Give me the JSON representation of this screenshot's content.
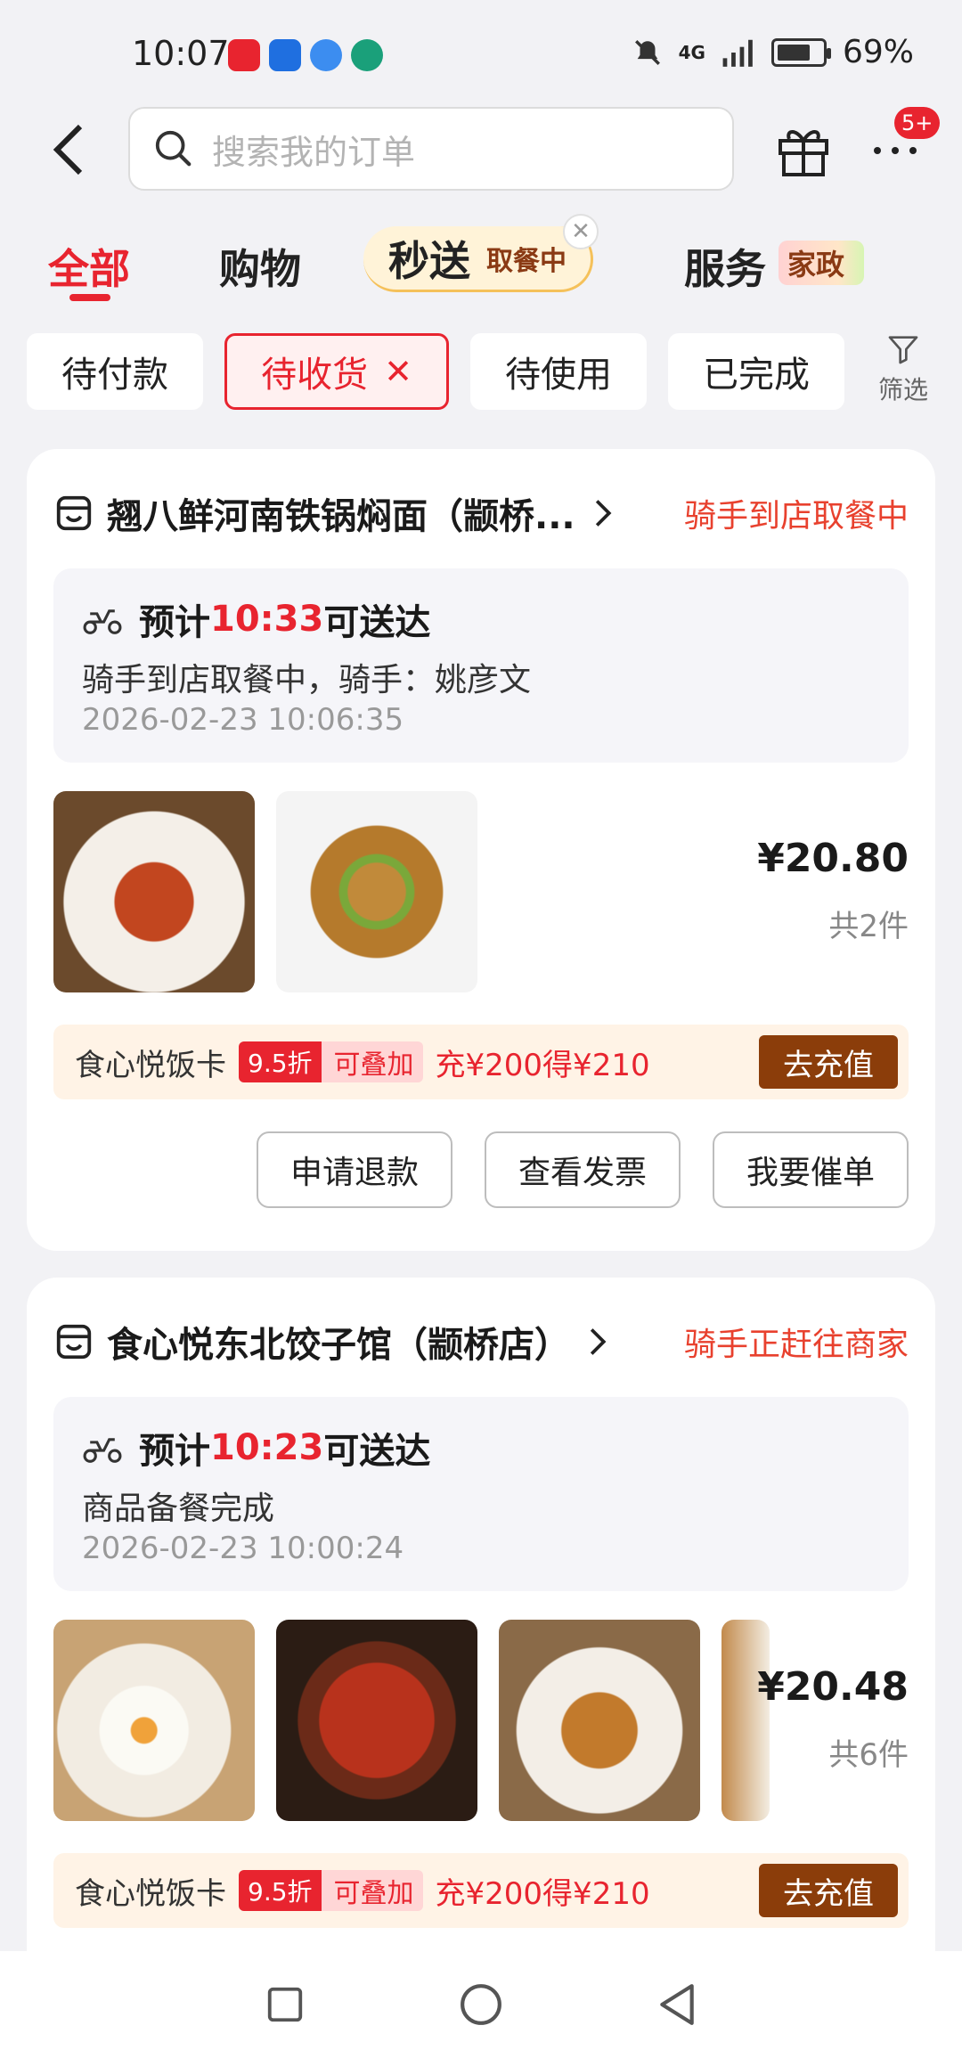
{
  "status_bar": {
    "time": "10:07",
    "battery": "69%",
    "network": "4G",
    "icons": [
      "app-icon-red",
      "app-icon-blue",
      "app-icon-lightblue",
      "app-icon-green",
      "mute-icon",
      "signal-icon",
      "battery-icon"
    ]
  },
  "header": {
    "search_placeholder": "搜索我的订单",
    "more_badge": "5+"
  },
  "tabs": [
    {
      "label": "全部",
      "active": true
    },
    {
      "label": "购物",
      "active": false
    },
    {
      "label": "秒送",
      "sub": "取餐中",
      "active": false
    },
    {
      "label": "服务",
      "tag": "家政",
      "active": false
    }
  ],
  "filters": {
    "chips": [
      {
        "label": "待付款",
        "active": false
      },
      {
        "label": "待收货",
        "active": true
      },
      {
        "label": "待使用",
        "active": false
      },
      {
        "label": "已完成",
        "active": false
      }
    ],
    "filter_label": "筛选"
  },
  "orders": [
    {
      "shop_name": "翘八鲜河南铁锅焖面（颛桥...",
      "status": "骑手到店取餐中",
      "eta_prefix": "预计",
      "eta_time": "10:33",
      "eta_suffix": "可送达",
      "desc": "骑手到店取餐中，骑手：姚彦文",
      "timestamp": "2026-02-23 10:06:35",
      "items": [
        "braised-chicken-leg",
        "stir-fried-noodles"
      ],
      "price": "¥20.80",
      "count": "共2件",
      "promo": {
        "name": "食心悦饭卡",
        "discount": "9.5折",
        "stack": "可叠加",
        "offer": "充¥200得¥210",
        "button": "去充值"
      },
      "actions": [
        "申请退款",
        "查看发票",
        "我要催单"
      ]
    },
    {
      "shop_name": "食心悦东北饺子馆（颛桥店）",
      "status": "骑手正赶往商家",
      "eta_prefix": "预计",
      "eta_time": "10:23",
      "eta_suffix": "可送达",
      "desc": "商品备餐完成",
      "timestamp": "2026-02-23 10:00:24",
      "items": [
        "salted-egg",
        "braised-chicken-feet",
        "spicy-chicken-wings",
        "partial-item"
      ],
      "price": "¥20.48",
      "count": "共6件",
      "promo": {
        "name": "食心悦饭卡",
        "discount": "9.5折",
        "stack": "可叠加",
        "offer": "充¥200得¥210",
        "button": "去充值"
      }
    }
  ],
  "colors": {
    "accent_red": "#e8242f",
    "status_orange": "#e8412e",
    "recharge_brown": "#8b3d0a",
    "page_bg": "#f2f2f5"
  }
}
